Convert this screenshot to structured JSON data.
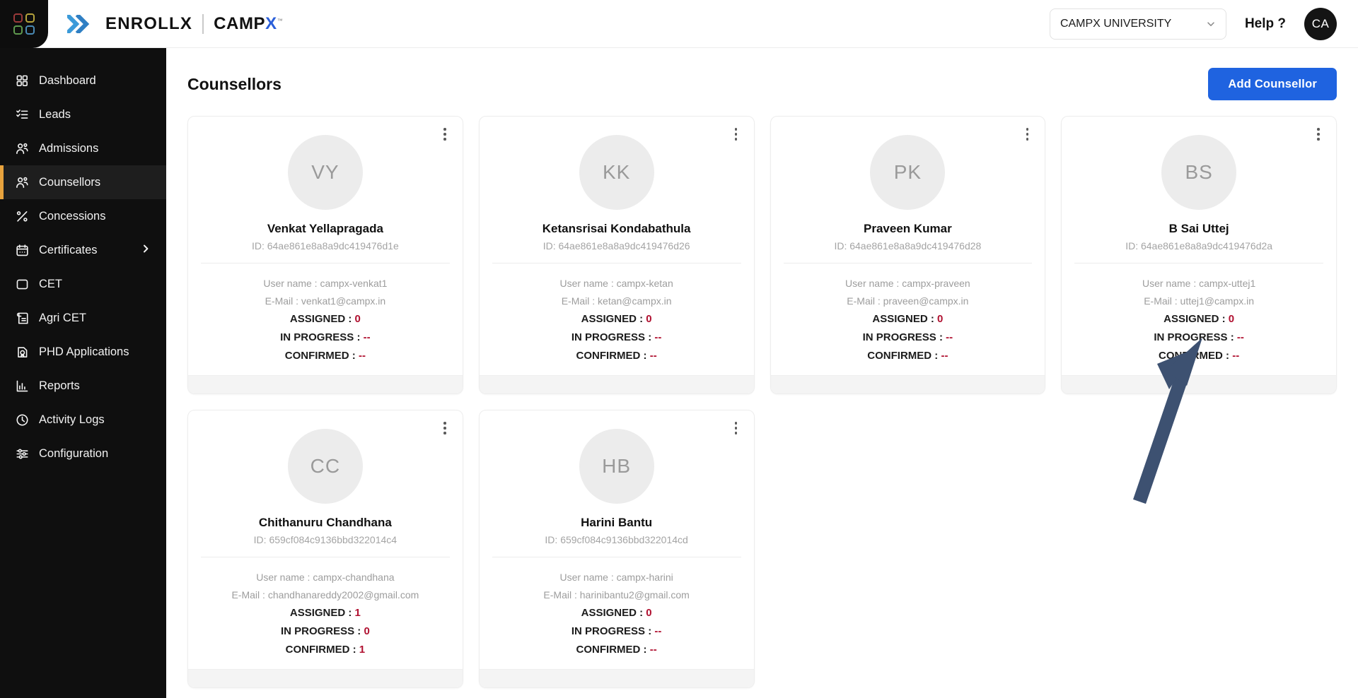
{
  "topbar": {
    "brand_enrollx": "ENROLLX",
    "brand_campx_main": "CAMP",
    "brand_campx_x": "X",
    "brand_tm": "™",
    "university": "CAMPX UNIVERSITY",
    "help_label": "Help ?",
    "avatar_initials": "CA",
    "logo_colors": [
      "#9b3a3a",
      "#b5a33c",
      "#5f9a4e",
      "#4a8ab5"
    ],
    "accent_blue": "#2b5fd9"
  },
  "sidebar": {
    "active": "Counsellors",
    "active_marker_color": "#e8a33d",
    "items": [
      {
        "label": "Dashboard",
        "icon": "grid-icon",
        "has_chevron": false
      },
      {
        "label": "Leads",
        "icon": "checklist-icon",
        "has_chevron": false
      },
      {
        "label": "Admissions",
        "icon": "users-icon",
        "has_chevron": false
      },
      {
        "label": "Counsellors",
        "icon": "users-icon",
        "has_chevron": false
      },
      {
        "label": "Concessions",
        "icon": "percent-icon",
        "has_chevron": false
      },
      {
        "label": "Certificates",
        "icon": "calendar-icon",
        "has_chevron": true
      },
      {
        "label": "CET",
        "icon": "square-icon",
        "has_chevron": false
      },
      {
        "label": "Agri CET",
        "icon": "document-lines-icon",
        "has_chevron": false
      },
      {
        "label": "PHD Applications",
        "icon": "document-badge-icon",
        "has_chevron": false
      },
      {
        "label": "Reports",
        "icon": "bar-chart-icon",
        "has_chevron": false
      },
      {
        "label": "Activity Logs",
        "icon": "clock-icon",
        "has_chevron": false
      },
      {
        "label": "Configuration",
        "icon": "sliders-icon",
        "has_chevron": false
      }
    ]
  },
  "main": {
    "page_title": "Counsellors",
    "add_button": "Add Counsellor",
    "add_button_color": "#1f63e0",
    "labels": {
      "id_prefix": "ID: ",
      "username_prefix": "User name : ",
      "email_prefix": "E-Mail : ",
      "assigned": "ASSIGNED : ",
      "in_progress": "IN PROGRESS : ",
      "confirmed": "CONFIRMED : "
    },
    "stat_value_color": "#b01030",
    "cards": [
      {
        "initials": "VY",
        "name": "Venkat Yellapragada",
        "id": "64ae861e8a8a9dc419476d1e",
        "username": "campx-venkat1",
        "email": "venkat1@campx.in",
        "assigned": "0",
        "in_progress": "--",
        "confirmed": "--"
      },
      {
        "initials": "KK",
        "name": "Ketansrisai Kondabathula",
        "id": "64ae861e8a8a9dc419476d26",
        "username": "campx-ketan",
        "email": "ketan@campx.in",
        "assigned": "0",
        "in_progress": "--",
        "confirmed": "--"
      },
      {
        "initials": "PK",
        "name": "Praveen Kumar",
        "id": "64ae861e8a8a9dc419476d28",
        "username": "campx-praveen",
        "email": "praveen@campx.in",
        "assigned": "0",
        "in_progress": "--",
        "confirmed": "--"
      },
      {
        "initials": "BS",
        "name": "B Sai Uttej",
        "id": "64ae861e8a8a9dc419476d2a",
        "username": "campx-uttej1",
        "email": "uttej1@campx.in",
        "assigned": "0",
        "in_progress": "--",
        "confirmed": "--"
      },
      {
        "initials": "CC",
        "name": "Chithanuru Chandhana",
        "id": "659cf084c9136bbd322014c4",
        "username": "campx-chandhana",
        "email": "chandhanareddy2002@gmail.com",
        "assigned": "1",
        "in_progress": "0",
        "confirmed": "1"
      },
      {
        "initials": "HB",
        "name": "Harini Bantu",
        "id": "659cf084c9136bbd322014cd",
        "username": "campx-harini",
        "email": "harinibantu2@gmail.com",
        "assigned": "0",
        "in_progress": "--",
        "confirmed": "--"
      }
    ]
  },
  "annotation": {
    "arrow_color": "#3d5171",
    "points_to": "B Sai Uttej card"
  }
}
